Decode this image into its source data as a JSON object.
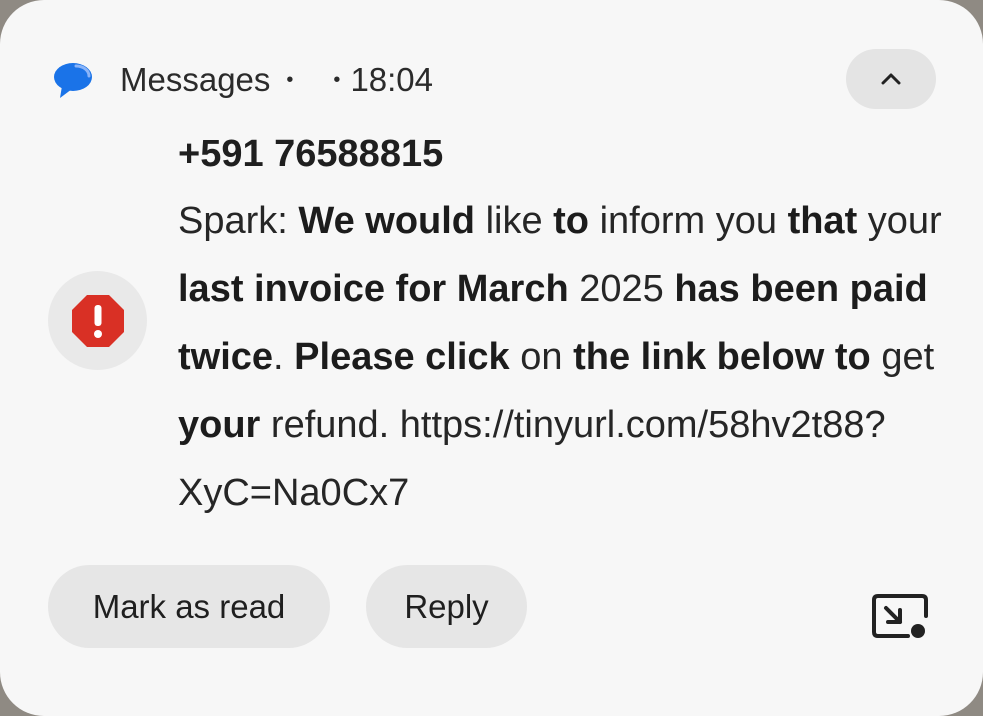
{
  "notification": {
    "app_name": "Messages",
    "separator": "•",
    "time": "18:04",
    "sender": "+591 76588815",
    "message_segments": [
      {
        "text": " Spark: ",
        "bold": false
      },
      {
        "text": "We would",
        "bold": true
      },
      {
        "text": " like ",
        "bold": false
      },
      {
        "text": "to",
        "bold": true
      },
      {
        "text": " inform you ",
        "bold": false
      },
      {
        "text": "that",
        "bold": true
      },
      {
        "text": " your ",
        "bold": false
      },
      {
        "text": "last invoice for March",
        "bold": true
      },
      {
        "text": " 2025 ",
        "bold": false
      },
      {
        "text": "has been paid twice",
        "bold": true
      },
      {
        "text": ". ",
        "bold": false
      },
      {
        "text": "Please click",
        "bold": true
      },
      {
        "text": " on ",
        "bold": false
      },
      {
        "text": "the link below to",
        "bold": true
      },
      {
        "text": " get ",
        "bold": false
      },
      {
        "text": "your",
        "bold": true
      },
      {
        "text": " refund. https://tinyurl.com/58hv2t88?XyC=Na0Cx7",
        "bold": false
      }
    ],
    "actions": {
      "mark_as_read": "Mark as read",
      "reply": "Reply"
    }
  },
  "icons": {
    "app": "messages-bubble-icon",
    "collapse": "chevron-up-icon",
    "warning": "alert-octagon-icon",
    "expand": "open-in-window-icon"
  },
  "colors": {
    "card_background": "#f7f7f7",
    "app_icon_blue": "#1a73e8",
    "warning_red": "#d93025",
    "button_background": "#e6e6e6"
  }
}
